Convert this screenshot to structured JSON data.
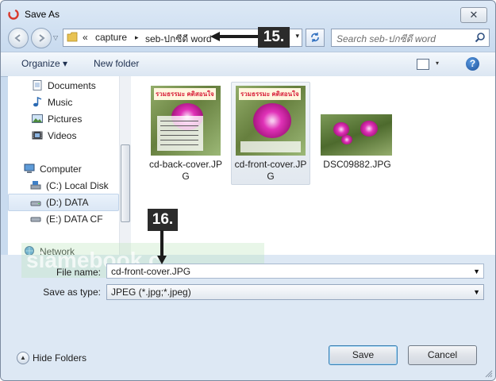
{
  "window": {
    "title": "Save As",
    "close_glyph": "✕"
  },
  "address": {
    "overflow": "«",
    "segments": [
      "capture",
      "seb-ปกซีดี word"
    ],
    "separator": "▸"
  },
  "search": {
    "placeholder": "Search seb-ปกซีดี word"
  },
  "callouts": {
    "step1": "15.",
    "step2": "16."
  },
  "toolbar": {
    "organize": "Organize ▾",
    "new_folder": "New folder"
  },
  "nav": {
    "items": [
      {
        "label": "Documents",
        "icon": "documents-icon"
      },
      {
        "label": "Music",
        "icon": "music-icon"
      },
      {
        "label": "Pictures",
        "icon": "pictures-icon"
      },
      {
        "label": "Videos",
        "icon": "videos-icon"
      },
      {
        "label": "Computer",
        "icon": "computer-icon"
      },
      {
        "label": "(C:) Local Disk",
        "icon": "drive-c-icon"
      },
      {
        "label": "(D:) DATA",
        "icon": "drive-d-icon",
        "selected": true
      },
      {
        "label": "(E:) DATA CF",
        "icon": "drive-e-icon"
      },
      {
        "label": "Network",
        "icon": "network-icon"
      }
    ]
  },
  "files": [
    {
      "name": "cd-back-cover.JPG",
      "banner": "รวมธรรมะ คติสอนใจ"
    },
    {
      "name": "cd-front-cover.JPG",
      "banner": "รวมธรรมะ คติสอนใจ",
      "selected": true
    },
    {
      "name": "DSC09882.JPG"
    }
  ],
  "form": {
    "file_name_label": "File name:",
    "file_name_value": "cd-front-cover.JPG",
    "save_type_label": "Save as type:",
    "save_type_value": "JPEG (*.jpg;*.jpeg)"
  },
  "footer": {
    "hide_folders": "Hide Folders",
    "save": "Save",
    "cancel": "Cancel"
  },
  "watermark": "siamebook.c..."
}
